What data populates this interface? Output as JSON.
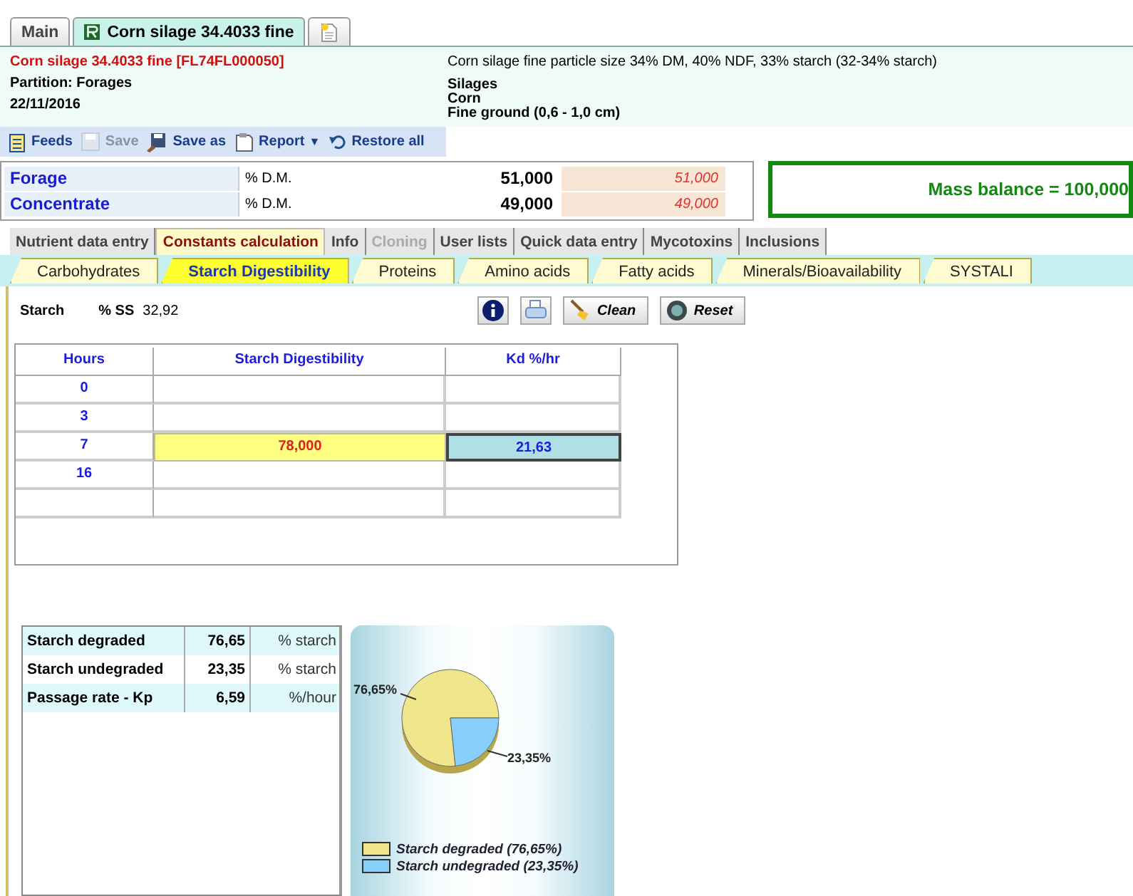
{
  "doc_tabs": [
    {
      "kind": "text",
      "label": "Main",
      "selected": false
    },
    {
      "kind": "feed",
      "label": "Corn silage 34.4033 fine",
      "selected": true
    },
    {
      "kind": "new",
      "selected": false
    }
  ],
  "header": {
    "title": "Corn silage 34.4033 fine [FL74FL000050]",
    "description": "Corn silage fine particle size 34% DM, 40% NDF, 33% starch (32-34% starch)",
    "partition": "Partition: Forages",
    "date": "22/11/2016",
    "categories": [
      "Silages",
      "Corn",
      "Fine ground (0,6 - 1,0 cm)"
    ]
  },
  "toolbar": [
    {
      "kind": "feeds",
      "label": "Feeds",
      "disabled": false
    },
    {
      "kind": "save",
      "label": "Save",
      "disabled": true
    },
    {
      "kind": "saveas",
      "label": "Save as",
      "disabled": false
    },
    {
      "kind": "report",
      "label": "Report",
      "disabled": false
    },
    {
      "kind": "dropdown",
      "label": "▼",
      "disabled": false
    },
    {
      "kind": "restore",
      "label": "Restore all",
      "disabled": false
    }
  ],
  "composition": [
    {
      "name": "Forage",
      "unit": "% D.M.",
      "value": "51,000",
      "computed": "51,000"
    },
    {
      "name": "Concentrate",
      "unit": "% D.M.",
      "value": "49,000",
      "computed": "49,000"
    }
  ],
  "mass_balance": "Mass balance = 100,000",
  "main_tabs": [
    {
      "label": "Nutrient data entry",
      "selected": false,
      "disabled": false
    },
    {
      "label": "Constants calculation",
      "selected": true,
      "disabled": false
    },
    {
      "label": "Info",
      "selected": false,
      "disabled": false
    },
    {
      "label": "Cloning",
      "selected": false,
      "disabled": true
    },
    {
      "label": "User lists",
      "selected": false,
      "disabled": false
    },
    {
      "label": "Quick data entry",
      "selected": false,
      "disabled": false
    },
    {
      "label": "Mycotoxins",
      "selected": false,
      "disabled": false
    },
    {
      "label": "Inclusions",
      "selected": false,
      "disabled": false
    }
  ],
  "sub_tabs": [
    {
      "label": "Carbohydrates",
      "selected": false
    },
    {
      "label": "Starch Digestibility",
      "selected": true
    },
    {
      "label": "Proteins",
      "selected": false
    },
    {
      "label": "Amino acids",
      "selected": false
    },
    {
      "label": "Fatty acids",
      "selected": false
    },
    {
      "label": "Minerals/Bioavailability",
      "selected": false
    },
    {
      "label": "SYSTALI",
      "selected": false
    }
  ],
  "starch": {
    "label": "Starch",
    "unit": "% SS",
    "value": "32,92"
  },
  "actions": [
    {
      "kind": "info"
    },
    {
      "kind": "print"
    },
    {
      "kind": "clean",
      "label": "Clean"
    },
    {
      "kind": "reset",
      "label": "Reset"
    }
  ],
  "grid": {
    "columns": [
      "Hours",
      "Starch Digestibility",
      "Kd %/hr"
    ],
    "rows": [
      {
        "hours": "0",
        "highlighted": false
      },
      {
        "hours": "3",
        "highlighted": false
      },
      {
        "hours": "7",
        "digestibility": "78,000",
        "kd": "21,63",
        "highlighted": true
      },
      {
        "hours": "16",
        "highlighted": false
      },
      {
        "highlighted": false
      }
    ]
  },
  "results": [
    {
      "label": "Starch degraded",
      "value": "76,65",
      "unit": "% starch"
    },
    {
      "label": "Starch undegraded",
      "value": "23,35",
      "unit": "% starch"
    },
    {
      "label": "Passage rate - Kp",
      "value": "6,59",
      "unit": "%/hour"
    }
  ],
  "chart": {
    "chart_data": {
      "type": "pie",
      "values": [
        76.65,
        23.35
      ],
      "value_labels": [
        "76,65%",
        "23,35%"
      ]
    },
    "legend": [
      {
        "label": "Starch degraded  (76,65%)",
        "color": "#f0e68c"
      },
      {
        "label": "Starch undegraded  (23,35%)",
        "color": "#87cefa"
      }
    ]
  }
}
